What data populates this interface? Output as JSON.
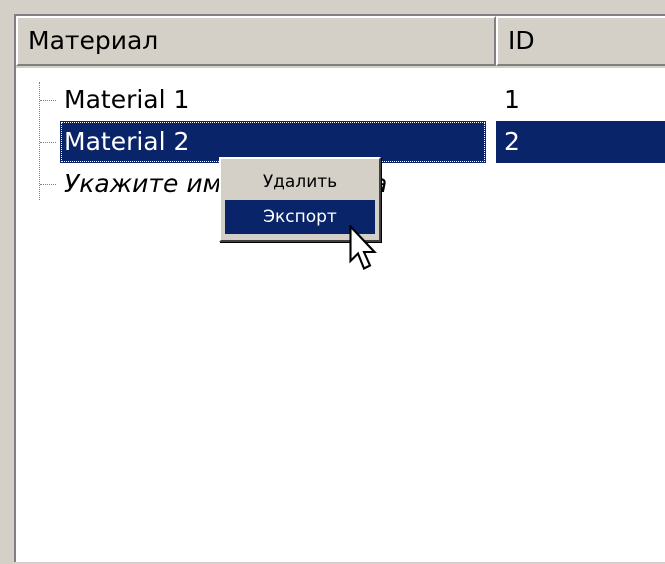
{
  "table": {
    "columns": {
      "material": "Материал",
      "id": "ID"
    },
    "rows": [
      {
        "name": "Material 1",
        "id": "1"
      },
      {
        "name": "Material 2",
        "id": "2"
      }
    ],
    "placeholder": "Укажите имя материала"
  },
  "context_menu": {
    "items": [
      "Удалить",
      "Экспорт"
    ]
  },
  "colors": {
    "selection": "#0a246a",
    "chrome": "#d4d0c8"
  },
  "icons": [
    "tree-connector-icon",
    "mouse-pointer-icon"
  ]
}
